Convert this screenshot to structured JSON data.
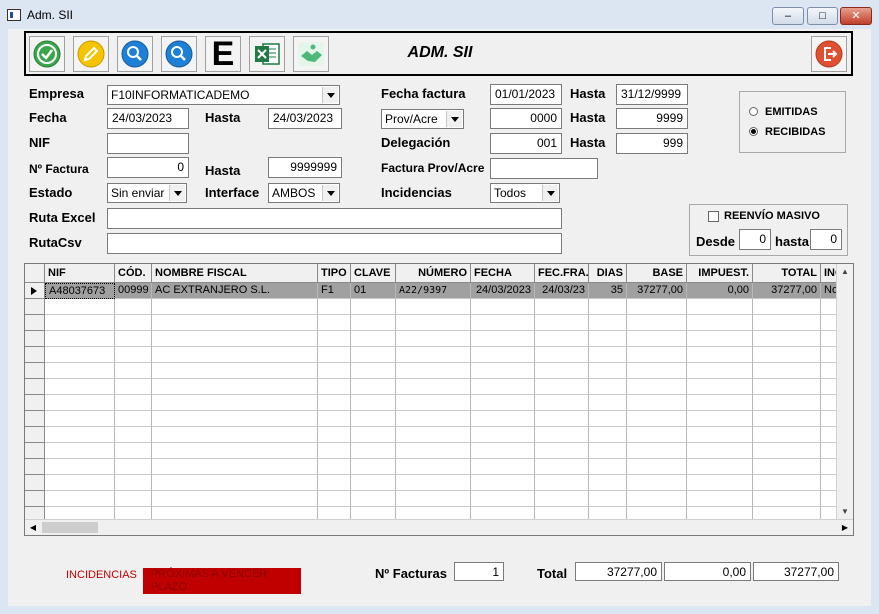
{
  "window": {
    "title": "Adm. SII"
  },
  "toolbar": {
    "title": "ADM. SII",
    "buttons": [
      {
        "name": "accept-button",
        "icon": "check-icon",
        "color": "#3aa84a"
      },
      {
        "name": "edit-button",
        "icon": "pencil-icon",
        "color": "#f5c400"
      },
      {
        "name": "search-button",
        "icon": "search-icon",
        "color": "#1e7fd6"
      },
      {
        "name": "search-advanced-button",
        "icon": "search-icon",
        "color": "#1e7fd6"
      },
      {
        "name": "export-e-button",
        "icon": "letter-e-icon",
        "label": "E"
      },
      {
        "name": "excel-button",
        "icon": "excel-icon",
        "color": "#1f7a45"
      },
      {
        "name": "handshake-button",
        "icon": "handshake-icon",
        "color": "#4cb87a"
      }
    ],
    "exit_icon_color": "#e05030"
  },
  "form": {
    "empresa": {
      "label": "Empresa",
      "value": "F10INFORMATICADEMO"
    },
    "fecha": {
      "label": "Fecha",
      "from": "24/03/2023",
      "hasta_label": "Hasta",
      "to": "24/03/2023"
    },
    "nif": {
      "label": "NIF",
      "value": ""
    },
    "num_factura": {
      "label": "Nº Factura",
      "from": "0",
      "hasta_label": "Hasta",
      "to": "9999999"
    },
    "estado": {
      "label": "Estado",
      "value": "Sin enviar"
    },
    "interface": {
      "label": "Interface",
      "value": "AMBOS"
    },
    "ruta_excel": {
      "label": "Ruta Excel",
      "value": ""
    },
    "ruta_csv": {
      "label": "RutaCsv",
      "value": ""
    },
    "fecha_factura": {
      "label": "Fecha factura",
      "from": "01/01/2023",
      "hasta_label": "Hasta",
      "to": "31/12/9999"
    },
    "prov_acre": {
      "value": "Prov/Acre",
      "from": "0000",
      "hasta_label": "Hasta",
      "to": "9999"
    },
    "delegacion": {
      "label": "Delegación",
      "from": "001",
      "hasta_label": "Hasta",
      "to": "999"
    },
    "factura_prov": {
      "label": "Factura Prov/Acre",
      "value": ""
    },
    "incidencias": {
      "label": "Incidencias",
      "value": "Todos"
    }
  },
  "mode": {
    "options": [
      {
        "label": "EMITIDAS",
        "selected": false
      },
      {
        "label": "RECIBIDAS",
        "selected": true
      }
    ]
  },
  "reenvio": {
    "checkbox_label": "REENVÍO MASIVO",
    "checked": false,
    "desde_label": "Desde",
    "desde": "0",
    "hasta_label": "hasta",
    "hasta": "0"
  },
  "grid": {
    "columns": [
      "NIF",
      "CÓD.",
      "NOMBRE FISCAL",
      "TIPO",
      "CLAVE",
      "NÚMERO",
      "FECHA",
      "FEC.FRA.",
      "DIAS",
      "BASE",
      "IMPUEST.",
      "TOTAL",
      "INC"
    ],
    "rows": [
      [
        "A48037673",
        "00999",
        "AC EXTRANJERO S.L.",
        "F1",
        "01",
        "A22/9397",
        "24/03/2023",
        "24/03/23",
        "35",
        "37277,00",
        "0,00",
        "37277,00",
        "No"
      ]
    ]
  },
  "footer": {
    "incidencias_label": "INCIDENCIAS",
    "proximas_label": "PRÓXIMAS A VENCER PLAZO",
    "num_facturas_label": "Nº Facturas",
    "num_facturas": "1",
    "total_label": "Total",
    "total_base": "37277,00",
    "total_impuestos": "0,00",
    "total": "37277,00"
  }
}
